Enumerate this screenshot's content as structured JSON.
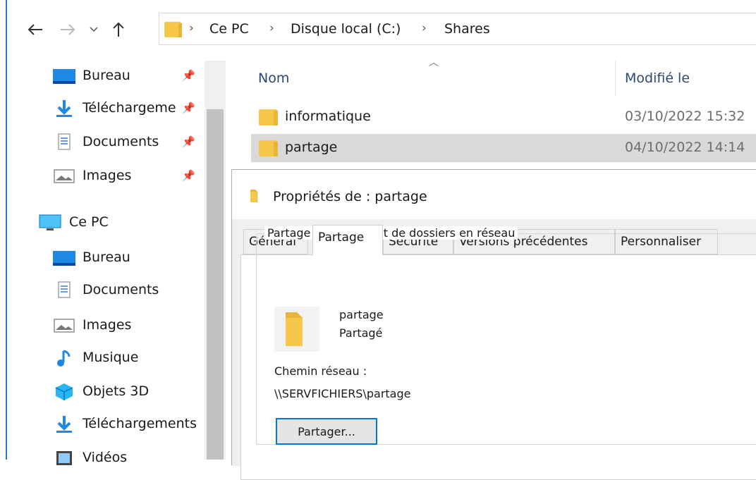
{
  "address": {
    "crumbs": [
      "Ce PC",
      "Disque local (C:)",
      "Shares"
    ]
  },
  "sidebar": {
    "quick_access": [
      {
        "label": "Bureau",
        "icon": "desktop-icon",
        "pinned": true
      },
      {
        "label": "Téléchargeme",
        "icon": "download-arrow-icon",
        "pinned": true
      },
      {
        "label": "Documents",
        "icon": "document-icon",
        "pinned": true
      },
      {
        "label": "Images",
        "icon": "image-icon",
        "pinned": true
      }
    ],
    "this_pc": {
      "label": "Ce PC",
      "icon": "computer-icon"
    },
    "pc_items": [
      {
        "label": "Bureau",
        "icon": "desktop-icon"
      },
      {
        "label": "Documents",
        "icon": "document-icon"
      },
      {
        "label": "Images",
        "icon": "image-icon"
      },
      {
        "label": "Musique",
        "icon": "music-note-icon"
      },
      {
        "label": "Objets 3D",
        "icon": "cube-3d-icon"
      },
      {
        "label": "Téléchargements",
        "icon": "download-arrow-icon"
      },
      {
        "label": "Vidéos",
        "icon": "video-icon"
      }
    ]
  },
  "file_list": {
    "columns": {
      "name": "Nom",
      "modified": "Modifié le"
    },
    "rows": [
      {
        "name": "informatique",
        "modified": "03/10/2022 15:32",
        "selected": false
      },
      {
        "name": "partage",
        "modified": "04/10/2022 14:14",
        "selected": true
      }
    ]
  },
  "dialog": {
    "title": "Propriétés de : partage",
    "tabs": [
      "Général",
      "Partage",
      "Sécurité",
      "Versions précédentes",
      "Personnaliser"
    ],
    "active_tab": "Partage",
    "group_label": "Partage de fichiers et de dossiers en réseau",
    "folder_name": "partage",
    "folder_status": "Partagé",
    "network_path_label": "Chemin réseau :",
    "network_path": "\\\\SERVFICHIERS\\partage",
    "share_button": "Partager..."
  },
  "colors": {
    "folder": "#f5c84c",
    "selection": "#d9d9d9",
    "accent": "#0078d7"
  }
}
